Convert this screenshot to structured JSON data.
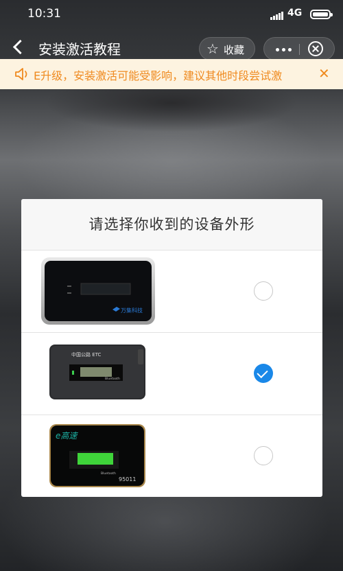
{
  "status_bar": {
    "time": "10:31",
    "network": "4G"
  },
  "nav": {
    "title": "安装激活教程",
    "favorite_label": "收藏"
  },
  "notice": {
    "text": "E升级，安装激活可能受影响，建议其他时段尝试激",
    "color": "#ef8a1f"
  },
  "modal": {
    "title": "请选择你收到的设备外形",
    "options": [
      {
        "device_label": "万集科技",
        "selected": false
      },
      {
        "device_label": "中国公路 ETC",
        "device_label_2": "Bluetooth",
        "selected": true
      },
      {
        "device_label": "e高速",
        "device_label_2": "Bluetooth",
        "device_label_3": "95011",
        "selected": false
      }
    ]
  },
  "colors": {
    "accent": "#1a88e8",
    "notice_bg": "#fdf3e0"
  }
}
